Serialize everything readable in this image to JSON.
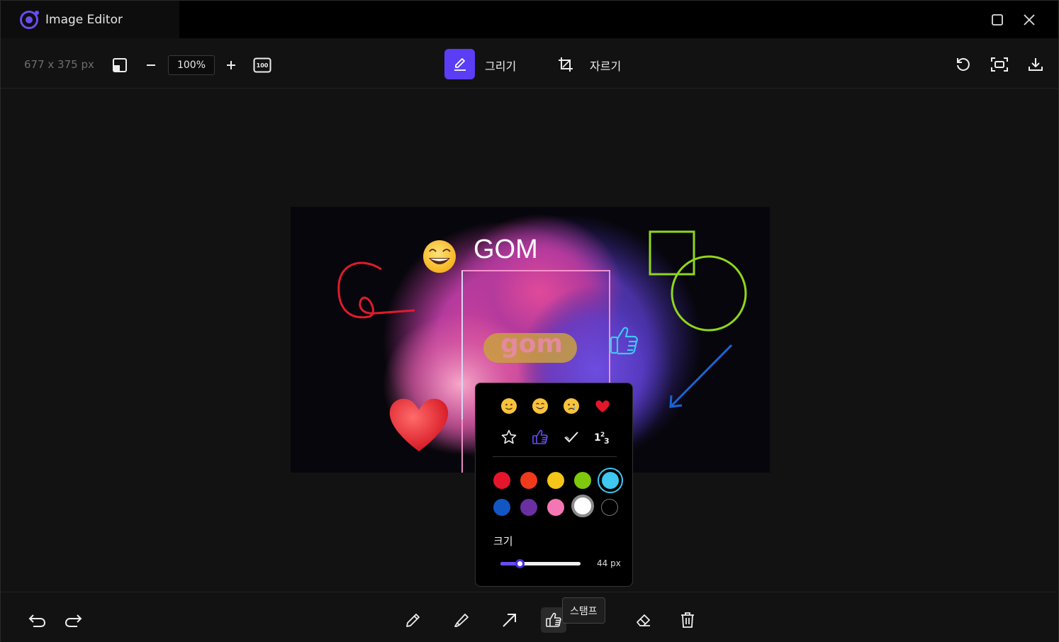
{
  "window": {
    "title": "Image Editor"
  },
  "toolbar": {
    "image_size": "677 x 375 px",
    "zoom_value": "100%",
    "actual_size_label": "100",
    "modes": [
      {
        "label": "그리기",
        "active": true
      },
      {
        "label": "자르기",
        "active": false
      }
    ]
  },
  "canvas": {
    "texts": [
      "GOM",
      "gom"
    ],
    "stamps": [
      "grin-stamp",
      "heart-stamp",
      "thumbs-up-stamp"
    ],
    "shapes": [
      "red-freehand",
      "green-square",
      "green-circle",
      "blue-arrow"
    ]
  },
  "stamp_popup": {
    "stamps": [
      "🙂",
      "😄",
      "😢",
      "❤️",
      "star",
      "thumbs-up",
      "check",
      "numbers"
    ],
    "selected_stamp": "thumbs-up",
    "colors": [
      "#e5162b",
      "#f03a1c",
      "#f5c518",
      "#7ec90c",
      "#3ec8f2",
      "#1256c4",
      "#6a2fa0",
      "#f477b3",
      "#ffffff",
      "#000000"
    ],
    "selected_color": "#3ec8f2",
    "size_label": "크기",
    "size_value": "44 px",
    "size_fraction": 0.24
  },
  "bottom_toolbar": {
    "active_tool": "stamp",
    "tooltip": "스탬프"
  },
  "colors": {
    "accent": "#5b3df5",
    "background": "#121212"
  }
}
